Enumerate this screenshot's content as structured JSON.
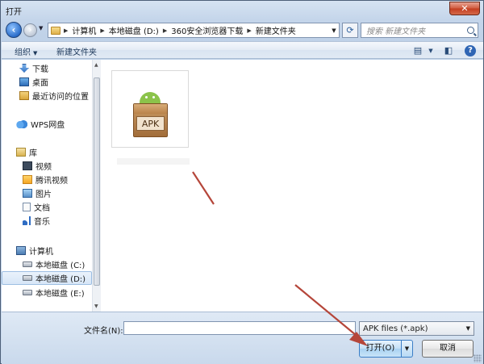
{
  "window": {
    "title": "打开",
    "close_label": "✕"
  },
  "address": {
    "crumbs": [
      "计算机",
      "本地磁盘 (D:)",
      "360安全浏览器下载",
      "新建文件夹"
    ],
    "search_placeholder": "搜索 新建文件夹"
  },
  "toolbar": {
    "organize_label": "组织",
    "new_folder_label": "新建文件夹"
  },
  "nav": {
    "items": [
      {
        "label": "下载"
      },
      {
        "label": "桌面"
      },
      {
        "label": "最近访问的位置"
      },
      {
        "label": "WPS网盘"
      },
      {
        "label": "库"
      },
      {
        "label": "视频"
      },
      {
        "label": "腾讯视频"
      },
      {
        "label": "图片"
      },
      {
        "label": "文档"
      },
      {
        "label": "音乐"
      },
      {
        "label": "计算机"
      },
      {
        "label": "本地磁盘 (C:)"
      },
      {
        "label": "本地磁盘 (D:)"
      },
      {
        "label": "本地磁盘 (E:)"
      }
    ],
    "selected_index": 12
  },
  "files": [
    {
      "icon_text": "APK",
      "icon": "apk-file-icon"
    }
  ],
  "footer": {
    "filename_label": "文件名(N):",
    "filename_value": "",
    "filter_value": "APK files (*.apk)",
    "open_label": "打开(O)",
    "cancel_label": "取消"
  },
  "colors": {
    "annotation_arrow": "#b5463a",
    "accent": "#3b7ec6"
  }
}
